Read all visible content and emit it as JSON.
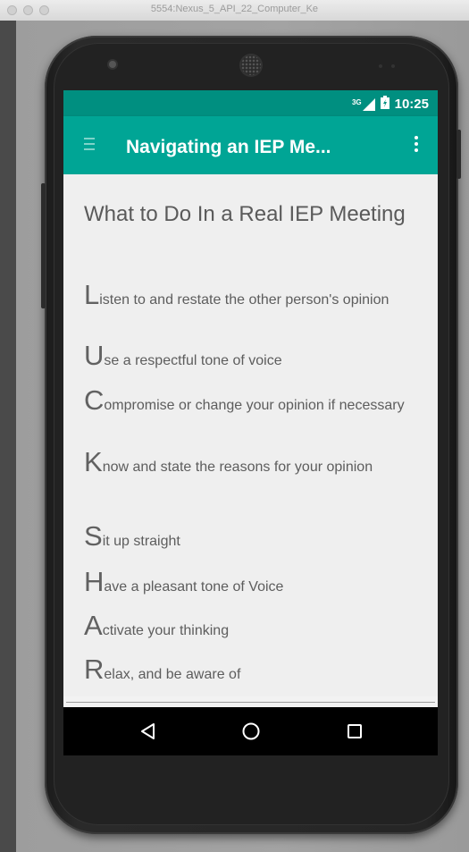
{
  "window": {
    "title": "5554:Nexus_5_API_22_Computer_Ke"
  },
  "status_bar": {
    "network": "3G",
    "time": "10:25"
  },
  "app_bar": {
    "title": "Navigating an IEP Me..."
  },
  "content": {
    "heading": "What to Do In a Real IEP Meeting",
    "listen": [
      {
        "letter": "L",
        "text": "isten to and restate the other person's opinion"
      },
      {
        "letter": "U",
        "text": "se a respectful tone of voice"
      },
      {
        "letter": "C",
        "text": "ompromise or change your opinion if necessary"
      },
      {
        "letter": "K",
        "text": "now and state the reasons for your opinion"
      }
    ],
    "share": [
      {
        "letter": "S",
        "text": "it up straight"
      },
      {
        "letter": "H",
        "text": "ave a pleasant tone of Voice"
      },
      {
        "letter": "A",
        "text": "ctivate your thinking"
      },
      {
        "letter": "R",
        "text": "elax, and be aware of"
      }
    ]
  },
  "colors": {
    "status_bar": "#008f80",
    "app_bar": "#00a595",
    "content_bg": "#efefef"
  }
}
